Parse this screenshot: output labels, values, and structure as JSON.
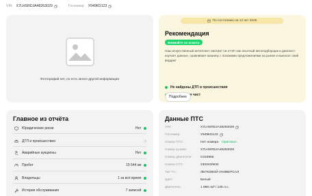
{
  "topbar": {
    "vin_label": "VIN",
    "vin_value": "X7LHSRDJA48263029",
    "plate_label": "Госномер",
    "plate_value": "У949КО123"
  },
  "photo": {
    "text": "Фотографий нет, но есть много другой информации"
  },
  "recommendation": {
    "date": "По состоянию на 12 окт 2025",
    "title": "Рекомендация",
    "badge": "Внимайте на осмотр",
    "description": "Наш искусственный интеллект смотрит на отчёт как опытный автоподборщик и диагност: изучает данные, сравнивает машину с похожими предложениями на рынке и выносит свой вердикт",
    "bullets": [
      "Не найдены ДТП и происшествия",
      "Юридически чист"
    ],
    "button": "Подробнее",
    "accent": "#1bd66d"
  },
  "report": {
    "title": "Главное из отчёта",
    "rows": [
      {
        "icon": "shield-icon",
        "label": "Юридические риски",
        "value": "Нет"
      },
      {
        "icon": "car-crash-icon",
        "label": "ДТП и происшествия",
        "value": ""
      },
      {
        "icon": "gavel-icon",
        "label": "Аварийные аукционы",
        "value": "Нет"
      },
      {
        "icon": "speedometer-icon",
        "label": "Пробег",
        "value": "15 544 км"
      },
      {
        "icon": "user-icon",
        "label": "Владельцы",
        "value": "1 за всё время"
      },
      {
        "icon": "wrench-icon",
        "label": "История обслуживания",
        "value": "7 записей"
      }
    ]
  },
  "pts": {
    "title": "Данные ПТС",
    "rows": [
      {
        "label": "VIN:",
        "value": "X7LHSRDJA48263029",
        "extra": ""
      },
      {
        "label": "Госномер:",
        "value": "У949КО123",
        "extra": ""
      },
      {
        "label": "Номер ПТС:",
        "value": "Нет номера",
        "extra": "Оригинал"
      },
      {
        "label": "Номер кузова:",
        "value": "X7LHSRDJA48263029",
        "extra": ""
      },
      {
        "label": "Номер двигателя:",
        "value": "C019956",
        "extra": ""
      },
      {
        "label": "Номер СТС:",
        "value": "2303420634",
        "extra": ""
      },
      {
        "label": "Тип ТС:",
        "value": "ЛЕГКОВОЙ УНИВЕРСАЛ",
        "extra": ""
      },
      {
        "label": "Цвет:",
        "value": "Белый",
        "extra": ""
      },
      {
        "label": "Двигатель:",
        "value": "1 998 см³ / 135 л.с.",
        "extra": ""
      }
    ]
  }
}
